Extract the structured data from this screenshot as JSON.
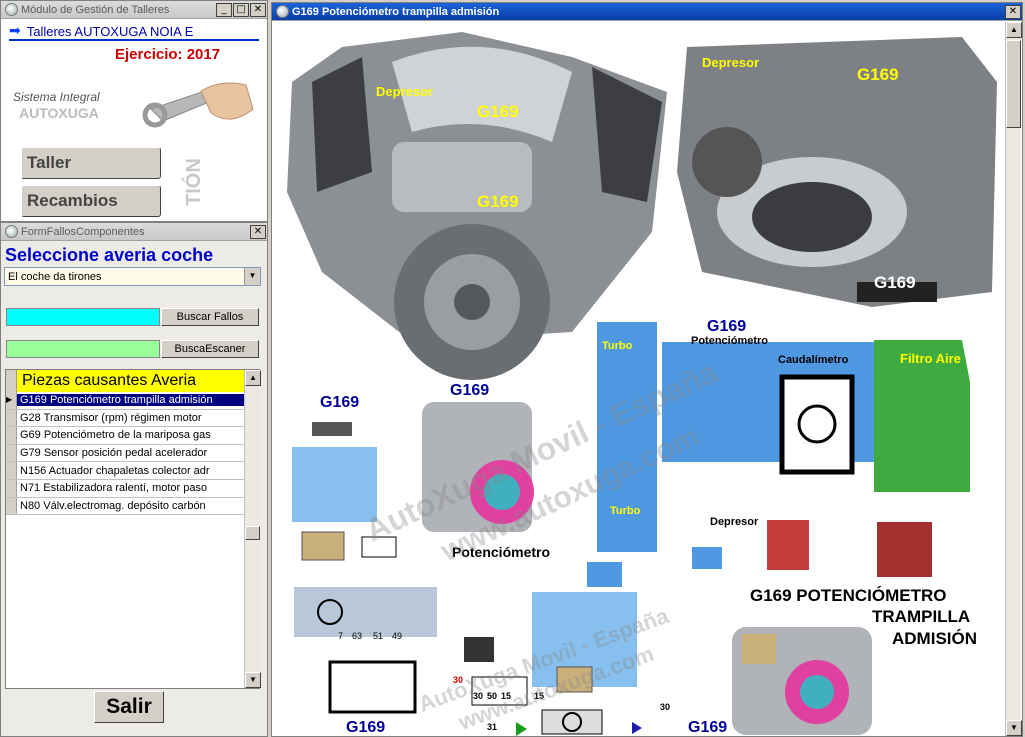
{
  "main_window": {
    "title": "Módulo de Gestión de Talleres",
    "shop_name": "Talleres AUTOXUGA NOIA E",
    "year_label": "Ejercicio: 2017",
    "brand_line1": "Sistema Integral",
    "brand_line2": "AUTOXUGA",
    "vertical_text": "TIÓN",
    "buttons": {
      "taller": "Taller",
      "recambios": "Recambios"
    }
  },
  "form": {
    "title": "FormFallosComponentes",
    "heading": "Seleccione averia coche",
    "selected_fault": "El coche da tirones",
    "search_faults": "Buscar Fallos",
    "search_scanner": "BuscaEscaner",
    "list_header": "Piezas causantes Averia",
    "items": [
      "G169 Potenciómetro trampilla admisión",
      "G28 Transmisor (rpm) régimen motor",
      "G69 Potenciómetro de la mariposa gas",
      "G79 Sensor posición pedal acelerador",
      "N156 Actuador chapaletas colector adr",
      "N71 Estabilizadora ralentí, motor paso",
      "N80 Válv.electromag. depósito carbón"
    ],
    "exit": "Salir"
  },
  "image_window": {
    "title": "G169 Potenciómetro trampilla admisión",
    "labels": {
      "depresor_a": "Depresor",
      "depresor_b": "Depresor",
      "depresor_c": "Depresor",
      "g169_a": "G169",
      "g169_b": "G169",
      "g169_c": "G169",
      "g169_d": "G169",
      "g169_e": "G169",
      "g169_f": "G169",
      "g169_g": "G169",
      "g169_h": "G169",
      "g169_i": "G169",
      "g169_j": "G169",
      "potenciometro_a": "Potenciómetro",
      "potenciometro_b": "Potenciómetro",
      "caudalimetro": "Caudalímetro",
      "filtro": "Filtro Aire",
      "turbo_a": "Turbo",
      "turbo_b": "Turbo",
      "caption_line1": "G169  POTENCIÓMETRO",
      "caption_line2": "TRAMPILLA",
      "caption_line3": "ADMISIÓN",
      "pin_7": "7",
      "pin_63": "63",
      "pin_51": "51",
      "pin_49": "49",
      "fuse_30a": "30",
      "fuse_30b": "30",
      "fuse_50": "50",
      "fuse_15a": "15",
      "fuse_15b": "15",
      "fuse_30c": "30",
      "fuse_31": "31"
    },
    "watermarks": [
      "AutoXuga Movil - España",
      "www.autoxuga.com",
      "AutoXuga Movil - España",
      "www.autoxuga.com"
    ]
  },
  "colors": {
    "header_blue": "#0000cc",
    "year_red": "#cc0000",
    "list_header_bg": "#ffff00",
    "selected_row": "#000080",
    "cyan_bar": "#00ffff",
    "green_bar": "#99ff99",
    "diagram_blue": "#4f98e2",
    "filter_green": "#3faa3f"
  }
}
